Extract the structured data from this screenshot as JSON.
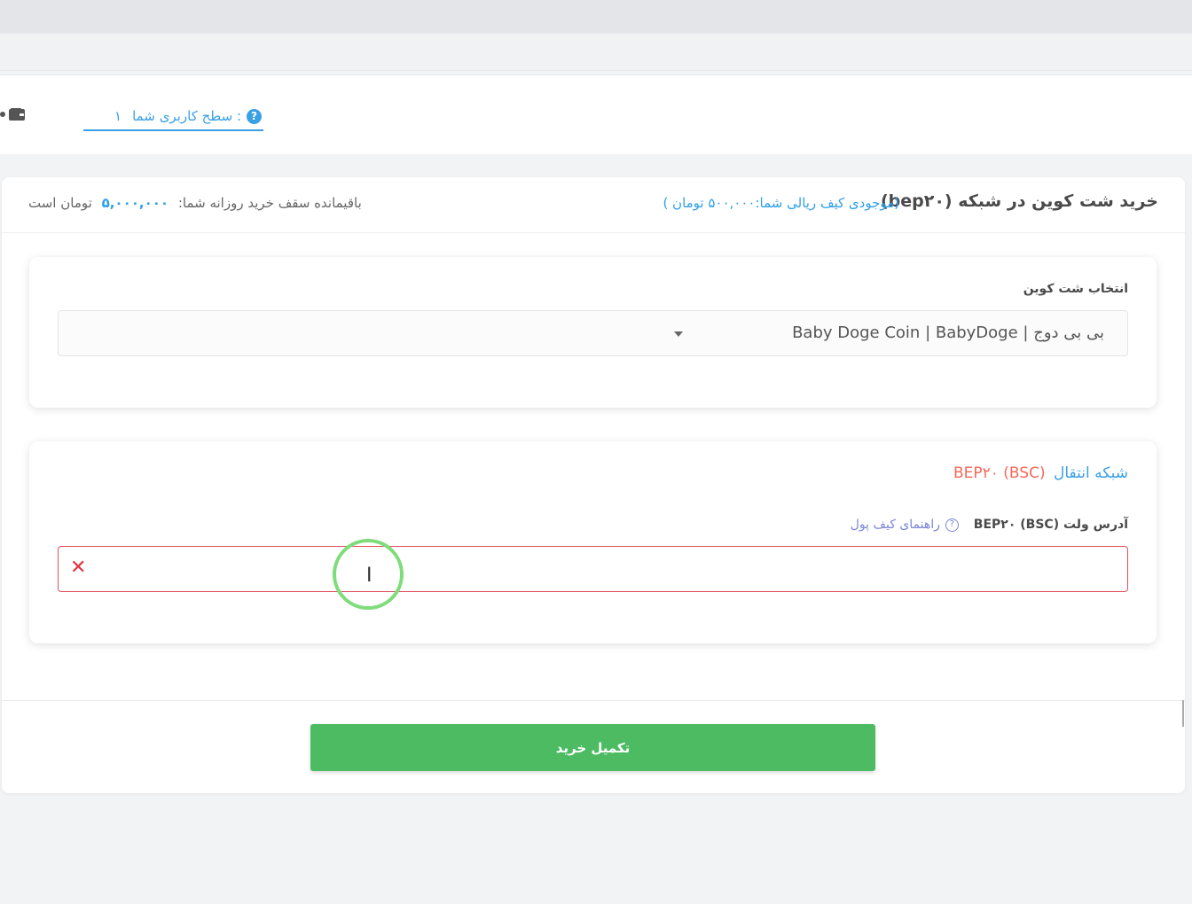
{
  "header": {
    "user_level_label": "سطح کاربری شما  :",
    "user_level_value": "۱",
    "help_icon": "question-circle-icon",
    "wallet_icon": "wallet-icon"
  },
  "card": {
    "title": "خرید شت کوین در شبکه (bep۲۰)",
    "balance": "(موجودی کیف ریالی شما:۵۰۰,۰۰۰ تومان )",
    "limit_prefix": "باقیمانده سقف خرید روزانه شما:",
    "limit_amount": "۵,۰۰۰,۰۰۰",
    "limit_suffix": "تومان است"
  },
  "coin_select": {
    "label": "انتخاب شت کوین",
    "selected": "بی بی دوج | Baby Doge Coin | BabyDoge"
  },
  "network": {
    "label": "شبکه انتقال",
    "value": "BEP۲۰ (BSC)"
  },
  "address": {
    "label": "آدرس ولت (BSC) BEP۲۰",
    "guide": "راهنمای کیف پول",
    "value": "",
    "clear_icon": "close-icon",
    "clear_glyph": "✕"
  },
  "actions": {
    "submit_label": "تکمیل خرید"
  },
  "colors": {
    "accent": "#3aa0e6",
    "error": "#e0505c",
    "network_value": "#f26a5a",
    "submit": "#4cbb62"
  }
}
